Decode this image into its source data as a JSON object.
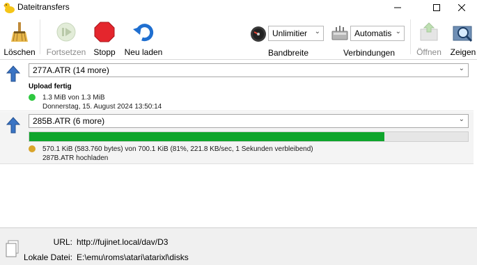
{
  "window": {
    "title": "Dateitransfers"
  },
  "toolbar": {
    "clear_label": "Löschen",
    "resume_label": "Fortsetzen",
    "stop_label": "Stopp",
    "reload_label": "Neu laden",
    "bandwidth_value": "Unlimitier",
    "bandwidth_caption": "Bandbreite",
    "connections_value": "Automatis",
    "connections_caption": "Verbindungen",
    "open_label": "Öffnen",
    "show_label": "Zeigen"
  },
  "transfers": [
    {
      "file": "277A.ATR (14 more)",
      "status": "Upload fertig",
      "size_text": "1.3 MiB von 1.3 MiB",
      "date_text": "Donnerstag, 15. August 2024 13:50:14",
      "dot_color": "#2ec840"
    },
    {
      "file": "285B.ATR (6 more)",
      "progress_percent": 81,
      "progress_text": "570.1 KiB (583.760 bytes) von 700.1 KiB (81%, 221.8 KB/sec, 1 Sekunden verbleibend)",
      "action_text": "287B.ATR hochladen",
      "dot_color": "#d9a42a",
      "bar_color": "#0fa52c"
    }
  ],
  "info": {
    "url_label": "URL:",
    "url_value": "http://fujinet.local/dav/D3",
    "local_label": "Lokale Datei:",
    "local_value": "E:\\emu\\roms\\atari\\atarixl\\disks"
  }
}
